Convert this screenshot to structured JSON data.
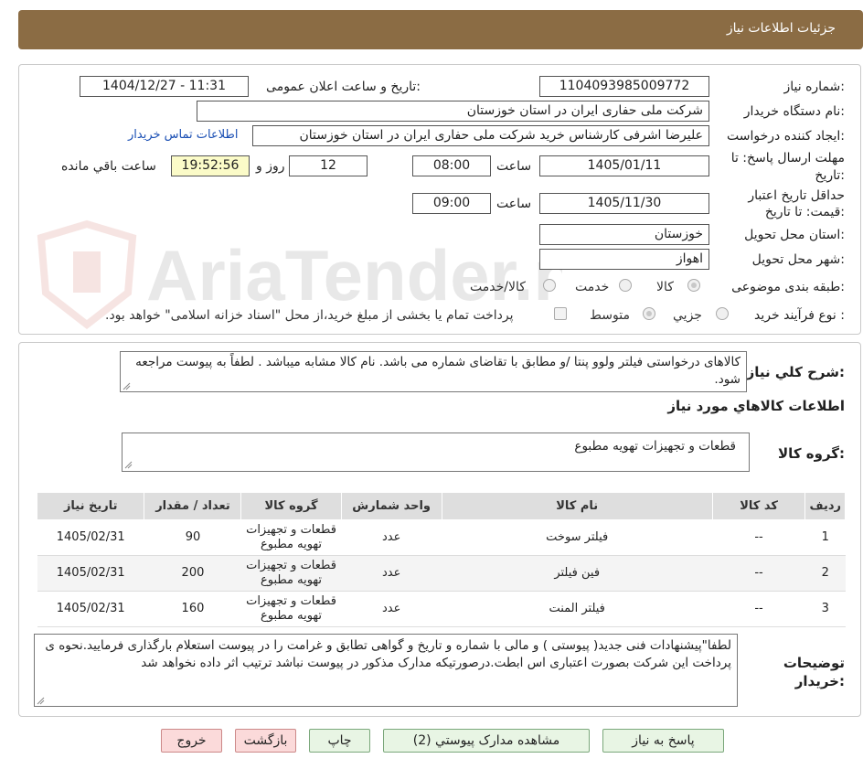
{
  "header": {
    "title": "جزئیات اطلاعات نیاز"
  },
  "form": {
    "need_number_label": "شماره نیاز:",
    "need_number": "1104093985009772",
    "announce_label": "تاریخ و ساعت اعلان عمومی:",
    "announce_value": "1404/12/27 - 11:31",
    "buyer_org_label": "نام دستگاه خریدار:",
    "buyer_org": "شرکت ملی حفاری ایران در استان خوزستان",
    "creator_label": "ایجاد کننده درخواست:",
    "creator": "علیرضا اشرفی کارشناس خرید شرکت ملی حفاری ایران در استان خوزستان",
    "contact_link": "اطلاعات تماس خریدار",
    "deadline_label_1": "مهلت ارسال پاسخ: تا",
    "deadline_label_2": "تاریخ:",
    "deadline_date": "1405/01/11",
    "time_label": "ساعت",
    "deadline_time": "08:00",
    "days_value": "12",
    "days_label": "روز و",
    "remaining_time": "19:52:56",
    "remaining_label": "ساعت باقي مانده",
    "validity_label_1": "حداقل تاريخ اعتبار",
    "validity_label_2": "قیمت: تا تاریخ:",
    "validity_date": "1405/11/30",
    "validity_time": "09:00",
    "province_label": "استان محل تحویل:",
    "province": "خوزستان",
    "city_label": "شهر محل تحویل:",
    "city": "اهواز",
    "category_label": "طبقه بندی موضوعی:",
    "category_options": [
      "کالا",
      "خدمت",
      "کالا/خدمت"
    ],
    "process_label": "نوع فرآیند خرید :",
    "process_options": [
      "جزیي",
      "متوسط"
    ],
    "process_note": "پرداخت تمام یا بخشی از مبلغ خرید،از محل \"اسناد خزانه اسلامی\" خواهد بود."
  },
  "summary": {
    "label": "شرح کلي نياز:",
    "text": "کالاهای درخواستی فیلتر ولوو پنتا /و  مطابق با تقاضای شماره می باشد. نام کالا مشابه میباشد . لطفاً به پیوست مراجعه شود.",
    "goods_info_title": "اطلاعات کالاهاي مورد نياز",
    "group_label": "گروه کالا:",
    "group_value": "قطعات و تجهیزات تهویه مطبوع"
  },
  "table": {
    "headers": [
      "رديف",
      "کد کالا",
      "نام کالا",
      "واحد شمارش",
      "گروه کالا",
      "تعداد / مقدار",
      "تاريخ نياز"
    ],
    "rows": [
      [
        "1",
        "--",
        "فیلتر سوخت",
        "عدد",
        "قطعات و تجهیزات تهویه مطبوع",
        "90",
        "1405/02/31"
      ],
      [
        "2",
        "--",
        "فین فیلتر",
        "عدد",
        "قطعات و تجهیزات تهویه مطبوع",
        "200",
        "1405/02/31"
      ],
      [
        "3",
        "--",
        "فیلتر المنت",
        "عدد",
        "قطعات و تجهیزات تهویه مطبوع",
        "160",
        "1405/02/31"
      ]
    ]
  },
  "notes": {
    "label_1": "توضيحات",
    "label_2": "خريدار:",
    "text": "لطفا\"پیشنهادات فنی جدید( پیوستی ) و مالی با شماره و تاریخ و گواهی تطابق و غرامت را در پیوست استعلام بارگذاری فرمایید.نحوه ی پرداخت این شرکت بصورت اعتباری اس ابطت.درصورتیکه مدارک مذکور در پیوست نباشد ترتیب اثر داده نخواهد شد"
  },
  "buttons": {
    "reply": "پاسخ به نیاز",
    "attachments": "مشاهده مدارک پیوستي (2)",
    "print": "چاپ",
    "back": "بازگشت",
    "exit": "خروج"
  },
  "watermark": {
    "text": "AriaTender.neT"
  },
  "colors": {
    "header_bg": "#8b6c44",
    "link": "#1a4fb4",
    "remaining_bg": "#fbfbc8"
  }
}
